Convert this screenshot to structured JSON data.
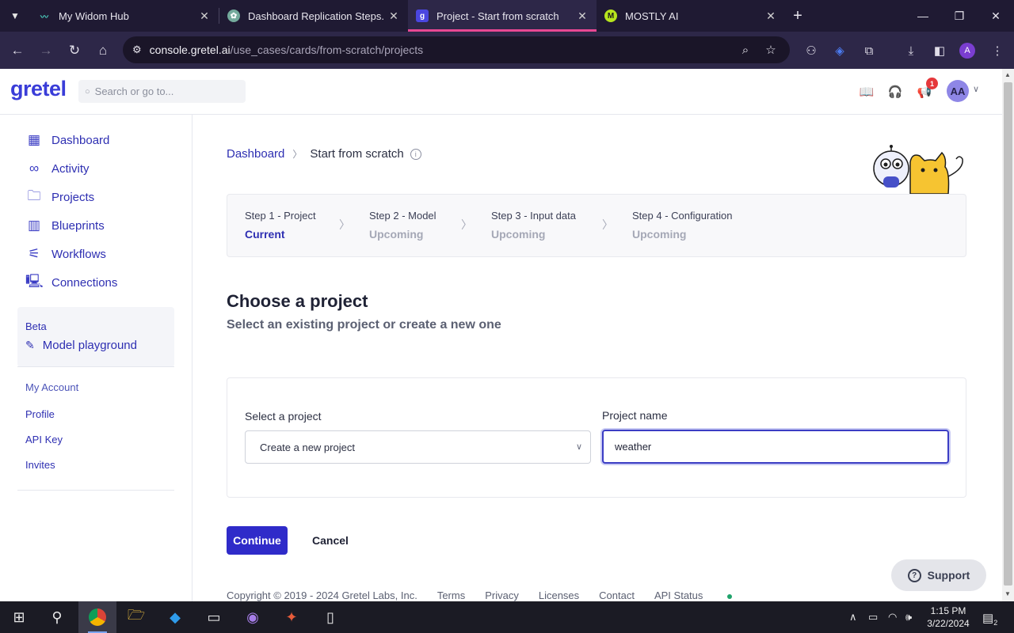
{
  "browser": {
    "tabs": [
      {
        "title": "My Widom Hub",
        "favicon": "widom-icon",
        "active": false
      },
      {
        "title": "Dashboard Replication Steps.",
        "favicon": "openai-icon",
        "active": false
      },
      {
        "title": "Project - Start from scratch",
        "favicon": "gretel-icon",
        "active": true
      },
      {
        "title": "MOSTLY AI",
        "favicon": "mostly-ai-icon",
        "active": false
      }
    ],
    "url_host": "console.gretel.ai",
    "url_path": "/use_cases/cards/from-scratch/projects",
    "tab_active_color": "#e84893"
  },
  "header": {
    "logo": "gretel",
    "search_placeholder": "Search or go to...",
    "notification_count": "1",
    "avatar_initials": "AA"
  },
  "sidebar": {
    "items": [
      {
        "label": "Dashboard",
        "icon": "grid-icon"
      },
      {
        "label": "Activity",
        "icon": "binoculars-icon"
      },
      {
        "label": "Projects",
        "icon": "folder-icon"
      },
      {
        "label": "Blueprints",
        "icon": "blueprint-icon"
      },
      {
        "label": "Workflows",
        "icon": "workflow-icon"
      },
      {
        "label": "Connections",
        "icon": "connection-icon"
      }
    ],
    "beta_label": "Beta",
    "playground_label": "Model playground",
    "account_heading": "My Account",
    "account_links": [
      "Profile",
      "API Key",
      "Invites"
    ]
  },
  "breadcrumb": {
    "root": "Dashboard",
    "current": "Start from scratch"
  },
  "steps": [
    {
      "title": "Step 1 - Project",
      "status": "Current"
    },
    {
      "title": "Step 2 - Model",
      "status": "Upcoming"
    },
    {
      "title": "Step 3 - Input data",
      "status": "Upcoming"
    },
    {
      "title": "Step 4 - Configuration",
      "status": "Upcoming"
    }
  ],
  "main": {
    "title": "Choose a project",
    "subtitle": "Select an existing project or create a new one",
    "select_label": "Select a project",
    "select_value": "Create a new project",
    "name_label": "Project name",
    "name_value": "weather",
    "continue_label": "Continue",
    "cancel_label": "Cancel",
    "support_label": "Support",
    "accent_color": "#2f2bc9"
  },
  "footer": {
    "copyright": "Copyright © 2019 - 2024 Gretel Labs, Inc.",
    "links": [
      "Terms",
      "Privacy",
      "Licenses",
      "Contact",
      "API Status"
    ]
  },
  "taskbar": {
    "time": "1:15 PM",
    "date": "3/22/2024",
    "notification_count": "2"
  }
}
